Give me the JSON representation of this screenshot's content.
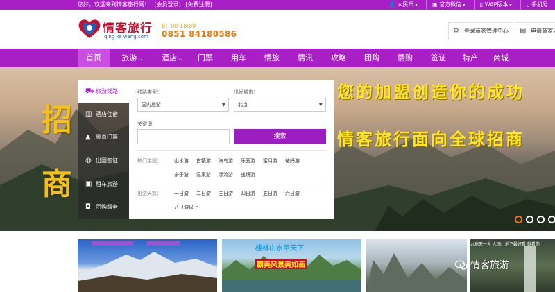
{
  "topbar": {
    "welcome": "您好，欢迎来到情客旅行网！",
    "login": "[会员登录]",
    "register": "[免费注册]",
    "right_items": [
      "人民币",
      "官方微信",
      "WAP版本",
      "手机号"
    ]
  },
  "header": {
    "logo_text": "情客旅行",
    "logo_sub": "qing ke wang.com",
    "hours": "8：00-18:00",
    "phone": "0851 84180586",
    "merchant_btn": "登录商家管理中心",
    "apply_btn": "申请商家入驻"
  },
  "nav": {
    "items": [
      "首页",
      "旅游",
      "酒店",
      "门票",
      "用车",
      "情旅",
      "情讯",
      "攻略",
      "团购",
      "情购",
      "签证",
      "特产",
      "商城"
    ]
  },
  "banner": {
    "char1": "招",
    "char2": "商",
    "slogan1": "您的加盟创造你的成功",
    "slogan2": "情客旅行面向全球招商"
  },
  "side": {
    "items": [
      "旅游线路",
      "酒店住宿",
      "景点门票",
      "出国签证",
      "租车旅游",
      "团购服务"
    ]
  },
  "search": {
    "type_label": "线路类型：",
    "type_value": "国内旅游",
    "city_label": "出发城市：",
    "city_value": "北京",
    "keyword_label": "关键词：",
    "keyword_value": "",
    "search_btn": "搜索",
    "hot_label": "热门主题：",
    "hot_tags": [
      "山水游",
      "古镇游",
      "海岛游",
      "乐园游",
      "蜜月游",
      "爸妈游",
      "亲子游",
      "温泉游",
      "漂流游",
      "出境游"
    ],
    "days_label": "出游天数：",
    "day_tags": [
      "一日游",
      "二日游",
      "三日游",
      "四日游",
      "五日游",
      "六日游",
      "八日游以上"
    ]
  },
  "thumbs": {
    "t2_caption1": "桂林山水甲天下",
    "t2_caption2": "霸美风景美如画",
    "t4_caption": "九树天一大 人间、地下最好看 就看你"
  },
  "watermark": "情客旅游"
}
